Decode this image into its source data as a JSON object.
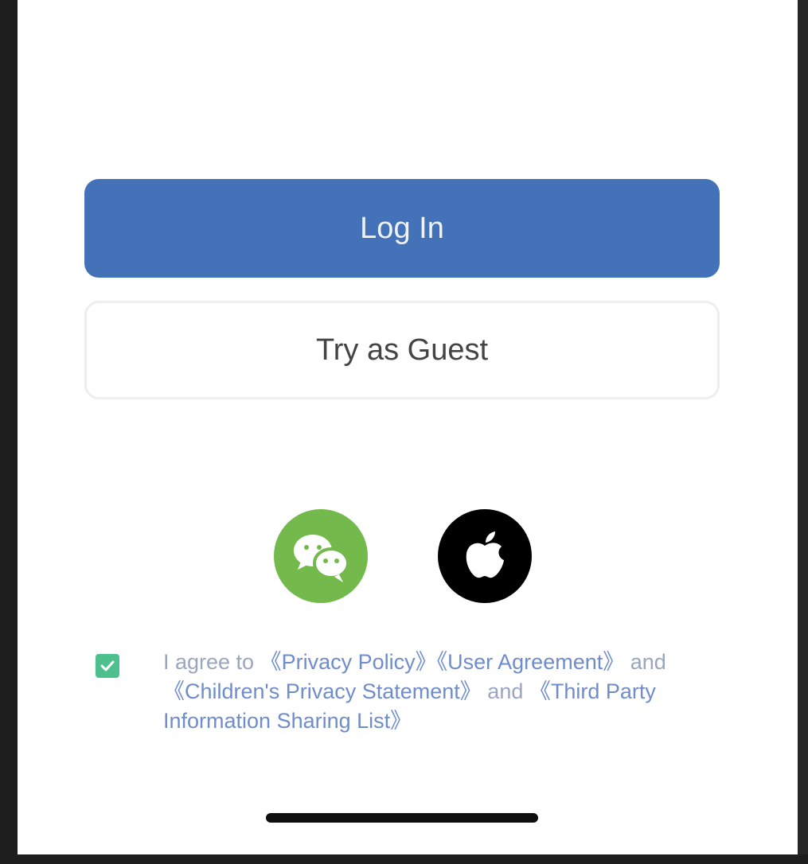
{
  "buttons": {
    "login_label": "Log In",
    "guest_label": "Try as Guest"
  },
  "social": {
    "wechat_icon": "wechat-icon",
    "apple_icon": "apple-icon"
  },
  "agreement": {
    "checked": true,
    "prefix": "I agree to ",
    "privacy_policy": "《Privacy Policy》",
    "user_agreement": "《User Agreement》",
    "and_1": " and ",
    "children_privacy": "《Children's Privacy Statement》",
    "and_2": " and ",
    "third_party": "《Third Party Information Sharing List》"
  },
  "colors": {
    "primary": "#4472b9",
    "wechat": "#74b94c",
    "apple": "#000000",
    "checkbox": "#4ec08d",
    "link": "#6f8ccc"
  }
}
